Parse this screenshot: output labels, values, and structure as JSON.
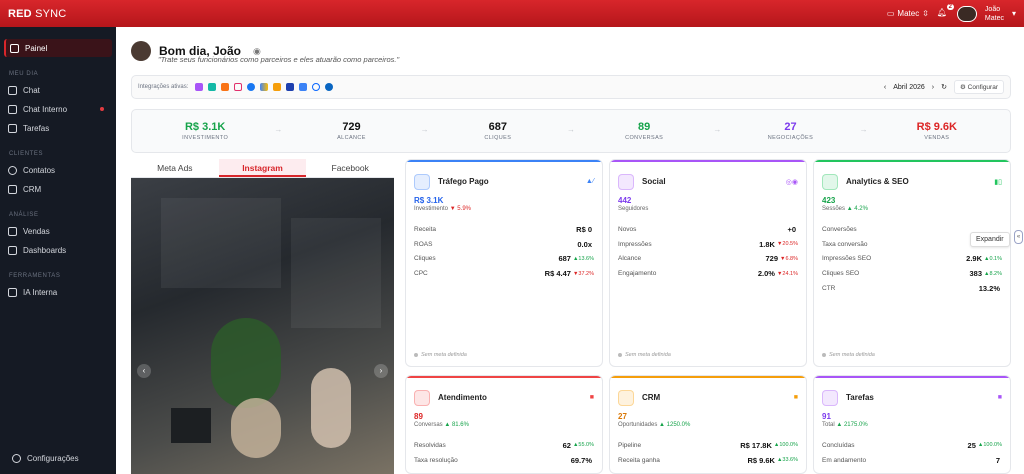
{
  "brand": {
    "bold": "RED",
    "rest": " SYNC"
  },
  "topbar": {
    "workspace": "Matec",
    "notif_count": "2",
    "user_name": "João",
    "user_org": "Matec"
  },
  "sidebar": {
    "active": "Painel",
    "sections": [
      {
        "title": "MEU DIA",
        "items": [
          "Chat",
          "Chat Interno",
          "Tarefas"
        ]
      },
      {
        "title": "CLIENTES",
        "items": [
          "Contatos",
          "CRM"
        ]
      },
      {
        "title": "ANÁLISE",
        "items": [
          "Vendas",
          "Dashboards"
        ]
      },
      {
        "title": "FERRAMENTAS",
        "items": [
          "IA Interna"
        ]
      }
    ],
    "footer": "Configurações"
  },
  "greeting": {
    "title": "Bom dia, João",
    "quote": "\"Trate seus funcionários como parceiros e eles atuarão como parceiros.\""
  },
  "integrations": {
    "label": "Integrações ativas:",
    "month": "Abril 2026",
    "configure": "Configurar",
    "icons": [
      "purple-app-icon",
      "teal-app-icon",
      "orange-app-icon",
      "instagram-icon",
      "facebook-icon",
      "google-ads-icon",
      "analytics-icon",
      "store-icon",
      "dashboard-icon",
      "meta-icon",
      "linkedin-icon"
    ]
  },
  "kpis": [
    {
      "value": "R$ 3.1K",
      "label": "INVESTIMENTO",
      "color": "#16a34a"
    },
    {
      "value": "729",
      "label": "ALCANCE",
      "color": "#111111"
    },
    {
      "value": "687",
      "label": "CLIQUES",
      "color": "#111111"
    },
    {
      "value": "89",
      "label": "CONVERSAS",
      "color": "#16a34a"
    },
    {
      "value": "27",
      "label": "NEGOCIAÇÕES",
      "color": "#7c3aed"
    },
    {
      "value": "R$ 9.6K",
      "label": "VENDAS",
      "color": "#dc2626"
    }
  ],
  "media": {
    "tabs": [
      "Meta Ads",
      "Instagram",
      "Facebook"
    ],
    "active_tab": "Instagram"
  },
  "cards": [
    {
      "title": "Tráfego Pago",
      "accent": "#3b82f6",
      "big": "R$ 3.1K",
      "big_color": "#2563eb",
      "sub": "Investimento",
      "delta": "▼ 5.9%",
      "delta_dir": "dn",
      "rows": [
        [
          "Receita",
          "R$ 0",
          ""
        ],
        [
          "ROAS",
          "0.0x",
          ""
        ],
        [
          "Cliques",
          "687",
          "▲13.6%"
        ],
        [
          "CPC",
          "R$ 4.47",
          "▼37.2%"
        ]
      ],
      "footer": "Sem meta definida"
    },
    {
      "title": "Social",
      "accent": "#a855f7",
      "big": "442",
      "big_color": "#7c3aed",
      "sub": "Seguidores",
      "delta": "",
      "delta_dir": "",
      "rows": [
        [
          "Novos",
          "+0",
          ""
        ],
        [
          "Impressões",
          "1.8K",
          "▼20.5%"
        ],
        [
          "Alcance",
          "729",
          "▼6.8%"
        ],
        [
          "Engajamento",
          "2.0%",
          "▼24.1%"
        ]
      ],
      "footer": "Sem meta definida"
    },
    {
      "title": "Analytics & SEO",
      "accent": "#22c55e",
      "big": "423",
      "big_color": "#16a34a",
      "sub": "Sessões",
      "delta": "▲ 4.2%",
      "delta_dir": "up",
      "rows": [
        [
          "Conversões",
          "",
          ""
        ],
        [
          "Taxa conversão",
          "0.00%",
          ""
        ],
        [
          "Impressões SEO",
          "2.9K",
          "▲0.1%"
        ],
        [
          "Cliques SEO",
          "383",
          "▲8.2%"
        ],
        [
          "CTR",
          "13.2%",
          ""
        ]
      ],
      "footer": "Sem meta definida"
    },
    {
      "title": "Atendimento",
      "accent": "#ef4444",
      "big": "89",
      "big_color": "#dc2626",
      "sub": "Conversas",
      "delta": "▲ 81.6%",
      "delta_dir": "up",
      "rows": [
        [
          "Resolvidas",
          "62",
          "▲55.0%"
        ],
        [
          "Taxa resolução",
          "69.7%",
          ""
        ]
      ],
      "footer": ""
    },
    {
      "title": "CRM",
      "accent": "#f59e0b",
      "big": "27",
      "big_color": "#d97706",
      "sub": "Oportunidades",
      "delta": "▲ 1250.0%",
      "delta_dir": "up",
      "rows": [
        [
          "Pipeline",
          "R$ 17.8K",
          "▲100.0%"
        ],
        [
          "Receita ganha",
          "R$ 9.6K",
          "▲33.6%"
        ]
      ],
      "footer": ""
    },
    {
      "title": "Tarefas",
      "accent": "#a855f7",
      "big": "91",
      "big_color": "#7c3aed",
      "sub": "Total",
      "delta": "▲ 2175.0%",
      "delta_dir": "up",
      "rows": [
        [
          "Concluídas",
          "25",
          "▲100.0%"
        ],
        [
          "Em andamento",
          "7",
          ""
        ]
      ],
      "footer": ""
    }
  ],
  "tooltip": {
    "expand": "Expandir"
  }
}
